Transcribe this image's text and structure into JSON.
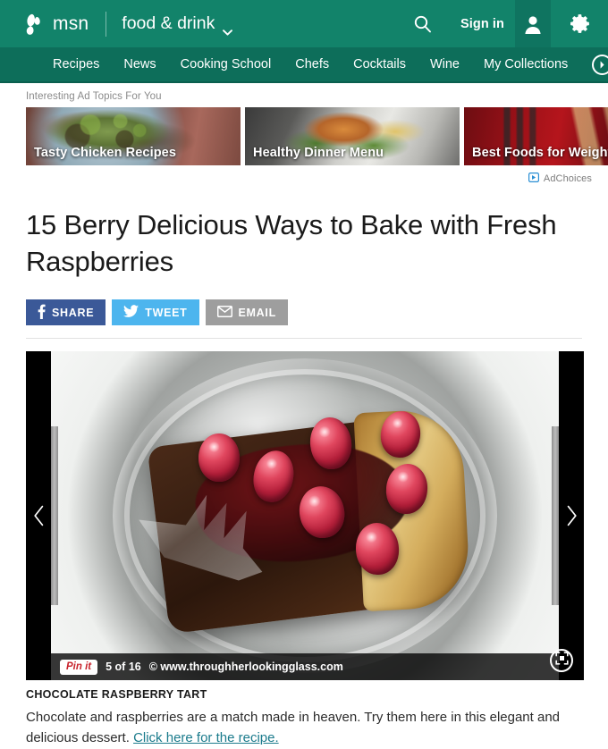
{
  "header": {
    "brand_name": "msn",
    "brand_logo_icon": "msn-butterfly-logo",
    "vertical": "food & drink",
    "vertical_caret_icon": "chevron-down-icon",
    "search_icon": "search-icon",
    "signin_label": "Sign in",
    "avatar_icon": "user-avatar-icon",
    "settings_icon": "gear-icon",
    "bar_color": "#12836a"
  },
  "nav": {
    "bar_color": "#0d6e5a",
    "items": [
      {
        "label": "Recipes"
      },
      {
        "label": "News"
      },
      {
        "label": "Cooking School"
      },
      {
        "label": "Chefs"
      },
      {
        "label": "Cocktails"
      },
      {
        "label": "Wine"
      },
      {
        "label": "My Collections"
      }
    ],
    "more_icon": "arrow-right-circle-icon"
  },
  "ads": {
    "strip_label": "Interesting Ad Topics For You",
    "cards": [
      {
        "title": "Tasty Chicken Recipes"
      },
      {
        "title": "Healthy Dinner Menu"
      },
      {
        "title": "Best Foods for Weight"
      }
    ],
    "adchoices_label": "AdChoices",
    "adchoices_icon": "adchoices-triangle-icon",
    "adchoices_color": "#2a8fd4"
  },
  "article": {
    "headline": "15 Berry Delicious Ways to Bake with Fresh Raspberries"
  },
  "share": {
    "facebook": {
      "label": "SHARE",
      "icon": "facebook-icon",
      "color": "#3b5998"
    },
    "twitter": {
      "label": "TWEET",
      "icon": "twitter-bird-icon",
      "color": "#4db5ee"
    },
    "email": {
      "label": "EMAIL",
      "icon": "envelope-icon",
      "color": "#9e9e9e"
    }
  },
  "viewer": {
    "prev_icon": "chevron-left-icon",
    "next_icon": "chevron-right-icon",
    "pinit_label": "Pin it",
    "counter": "5 of 16",
    "credit": "© www.throughherlookingglass.com",
    "expand_icon": "fullscreen-expand-icon",
    "photo_alt": "Slice of chocolate raspberry tart topped with glazed raspberries on a glass plate with a fork"
  },
  "caption": {
    "title": "CHOCOLATE RASPBERRY TART",
    "body": "Chocolate and raspberries are a match made in heaven. Try them here in this elegant and delicious dessert. ",
    "link_text": "Click here for the recipe.",
    "link_color": "#1b7b8c"
  }
}
